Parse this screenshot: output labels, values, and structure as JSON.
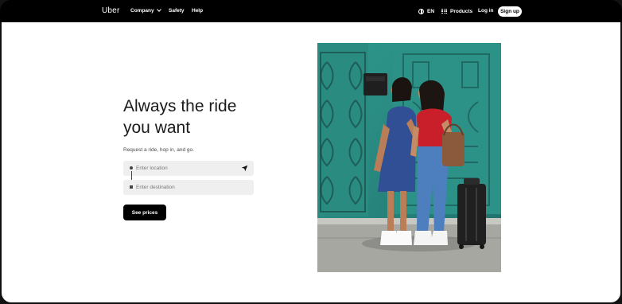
{
  "nav": {
    "logo": "Uber",
    "company": "Company",
    "safety": "Safety",
    "help": "Help",
    "language": "EN",
    "products": "Products",
    "login": "Log in",
    "signup": "Sign up"
  },
  "hero": {
    "headline_line1": "Always the ride",
    "headline_line2": "you want",
    "subtext": "Request a ride, hop in, and go.",
    "location_placeholder": "Enter location",
    "destination_placeholder": "Enter destination",
    "cta": "See prices"
  },
  "icons": {
    "company_dropdown": "chevron-down-icon",
    "language": "globe-icon",
    "products": "grid-icon",
    "location_marker": "dot-icon",
    "destination_marker": "square-icon",
    "current_location": "navigation-arrow-icon"
  },
  "colors": {
    "topbar": "#000000",
    "page_background": "#ffffff",
    "input_background": "#efefef",
    "primary_button": "#000000",
    "hero_photo_wall": "#2d8a80"
  }
}
